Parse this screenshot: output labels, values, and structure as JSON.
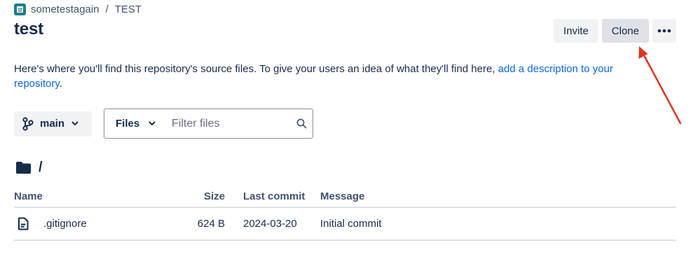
{
  "breadcrumb": {
    "project": "sometestagain",
    "separator": "/",
    "repo": "TEST"
  },
  "page_title": "test",
  "actions": {
    "invite": "Invite",
    "clone": "Clone"
  },
  "description": {
    "text": "Here's where you'll find this repository's source files. To give your users an idea of what they'll find here, ",
    "link": "add a description to your repository",
    "end": "."
  },
  "toolbar": {
    "branch": "main",
    "files_select": "Files",
    "filter_placeholder": "Filter files"
  },
  "path": {
    "root": "/"
  },
  "table": {
    "headers": {
      "name": "Name",
      "size": "Size",
      "last_commit": "Last commit",
      "message": "Message"
    },
    "rows": [
      {
        "name": ".gitignore",
        "size": "624 B",
        "last_commit": "2024-03-20",
        "message": "Initial commit"
      }
    ]
  },
  "colors": {
    "link": "#0c66e4",
    "annotation_arrow": "#e0341e",
    "text": "#172b4d"
  }
}
